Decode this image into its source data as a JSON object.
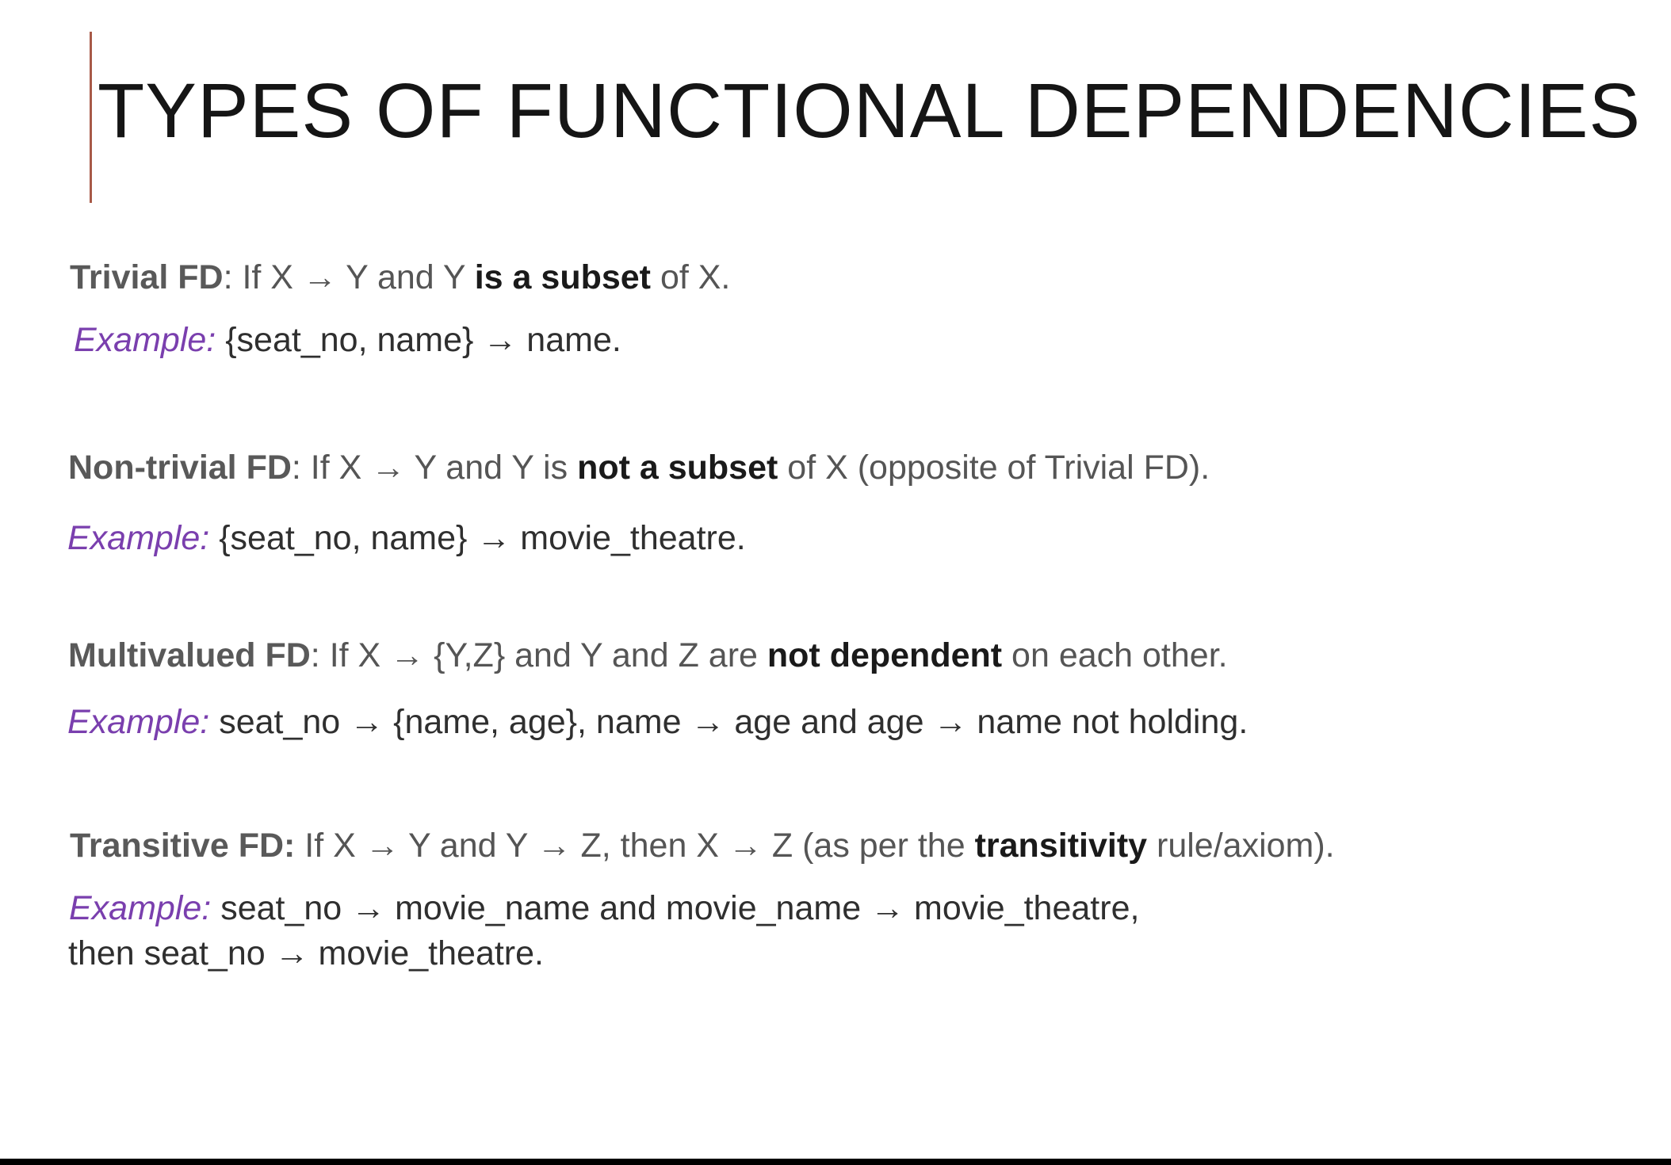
{
  "slide": {
    "title": "TYPES OF FUNCTIONAL DEPENDENCIES",
    "sections": [
      {
        "definition": {
          "label": "Trivial FD",
          "part1": ": If X → Y and Y ",
          "emphasis": "is a subset",
          "part2": " of X."
        },
        "example": {
          "label": "Example:",
          "line1": " {seat_no, name} → name.",
          "line2": ""
        }
      },
      {
        "definition": {
          "label": "Non-trivial FD",
          "part1": ": If X → Y and Y is ",
          "emphasis": "not a subset",
          "part2": " of X (opposite of Trivial FD)."
        },
        "example": {
          "label": "Example:",
          "line1": " {seat_no, name} → movie_theatre.",
          "line2": ""
        }
      },
      {
        "definition": {
          "label": "Multivalued FD",
          "part1": ": If X → {Y,Z} and Y and Z are ",
          "emphasis": "not dependent",
          "part2": " on each other."
        },
        "example": {
          "label": "Example:",
          "line1": " seat_no → {name, age},  name → age and age → name not holding.",
          "line2": ""
        }
      },
      {
        "definition": {
          "label": "Transitive FD:",
          "part1": " If X → Y and Y → Z, then X → Z (as per the ",
          "emphasis": "transitivity",
          "part2": " rule/axiom)."
        },
        "example": {
          "label": "Example:",
          "line1": " seat_no → movie_name and movie_name →  movie_theatre,",
          "line2": "then seat_no → movie_theatre."
        }
      }
    ]
  },
  "colors": {
    "accent_line": "#a85a48",
    "example_label": "#7a3fae",
    "bottom_bar": "#000000"
  }
}
